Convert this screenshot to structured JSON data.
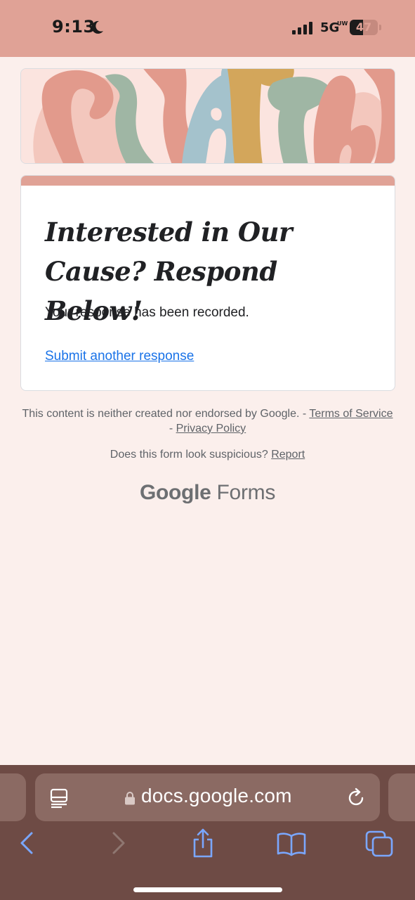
{
  "status_bar": {
    "time": "9:13",
    "network": "5G",
    "network_superscript": "UW",
    "battery_level": 47,
    "battery_text": "47",
    "icons": [
      "moon-icon",
      "signal-icon",
      "battery-icon"
    ]
  },
  "header_image": {
    "lettering": "FAITH"
  },
  "form": {
    "title": "Interested in Our Cause? Respond Below!",
    "confirmation": "Your response has been recorded.",
    "submit_another": "Submit another response"
  },
  "footer": {
    "disclaimer_text": "This content is neither created nor endorsed by Google. - ",
    "terms_link": "Terms of Service",
    "separator": " - ",
    "privacy_link": "Privacy Policy",
    "suspicious_text": "Does this form look suspicious? ",
    "report_link": "Report",
    "brand_google": "Google",
    "brand_forms": "Forms"
  },
  "browser": {
    "url": "docs.google.com",
    "icons": [
      "reader-icon",
      "lock-icon",
      "reload-icon",
      "back-icon",
      "forward-icon",
      "share-icon",
      "bookmarks-icon",
      "tabs-icon"
    ]
  },
  "colors": {
    "accent": "#e0a296",
    "page_background": "#fbefec",
    "link": "#1a73e8",
    "browser_bar": "#6e4b45",
    "browser_icon": "#7aa7ff"
  }
}
